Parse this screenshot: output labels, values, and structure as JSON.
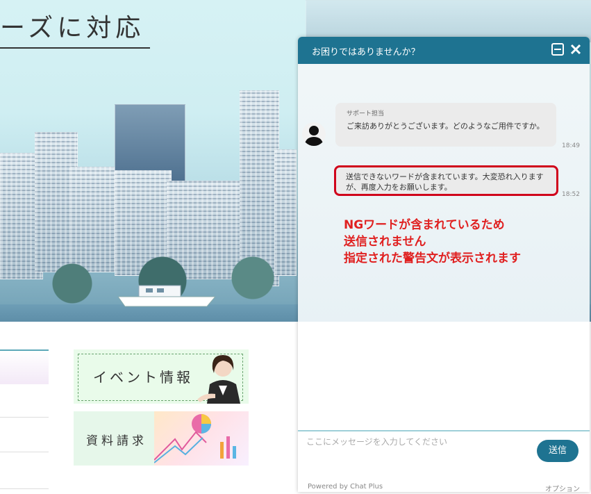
{
  "hero": {
    "title": "ーズに対応"
  },
  "banners": {
    "event_label": "イベント情報",
    "document_label": "資料請求"
  },
  "chat": {
    "header_title": "お困りではありませんか？",
    "message1": {
      "sender": "サポート担当",
      "text": "ご来訪ありがとうございます。どのようなご用件ですか。",
      "time": "18:49"
    },
    "message2": {
      "text": "送信できないワードが含まれています。大変恐れ入りますが、再度入力をお願いします。",
      "time": "18:52"
    },
    "annotation": {
      "line1": "NGワードが含まれているため",
      "line2": "送信されません",
      "line3": "指定された警告文が表示されます"
    },
    "input_placeholder": "ここにメッセージを入力してください",
    "send_label": "送信",
    "powered_by": "Powered by Chat Plus",
    "option_label": "オプション"
  },
  "colors": {
    "header": "#1e7391",
    "alert": "#e02020",
    "warning_border": "#d0021b"
  },
  "icons": {
    "minimize": "minimize-icon",
    "close": "close-icon",
    "avatar": "user-avatar-icon"
  }
}
